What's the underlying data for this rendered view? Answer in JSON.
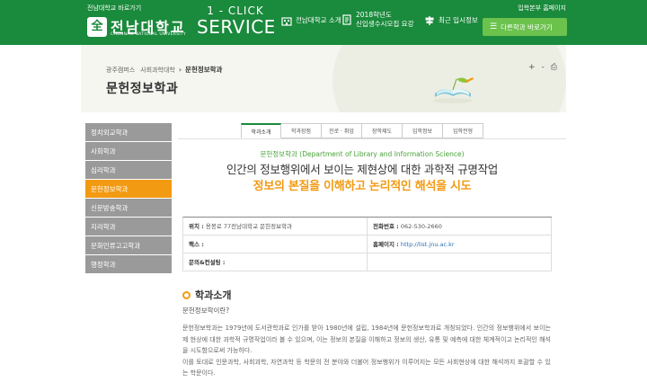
{
  "header": {
    "top_left_link": "전남대학교 바로가기",
    "top_right_link": "입학본부 홈페이지",
    "logo_ko": "전남대학교",
    "logo_en": "CHONNAM NATIONAL UNIVERSITY",
    "service_line1": "1 - CLICK",
    "service_line2": "SERVICE",
    "nav": [
      {
        "label": "전남대학교 소개",
        "icon": "building-icon"
      },
      {
        "label_line1": "2018학년도",
        "label_line2": "신입생수시모집 요강",
        "icon": "document-icon"
      },
      {
        "label": "최근 입시정보",
        "icon": "signpost-icon"
      }
    ],
    "quick_button": "다른학과 바로가기"
  },
  "banner": {
    "breadcrumb": [
      "광주캠퍼스",
      "사회과학대학",
      "문헌정보학과"
    ],
    "title": "문헌정보학과",
    "tools": [
      "+",
      "-",
      "⎙"
    ]
  },
  "sidebar": {
    "items": [
      {
        "label": "정치외교학과",
        "active": false
      },
      {
        "label": "사회학과",
        "active": false
      },
      {
        "label": "심리학과",
        "active": false
      },
      {
        "label": "문헌정보학과",
        "active": true
      },
      {
        "label": "신문방송학과",
        "active": false
      },
      {
        "label": "지리학과",
        "active": false
      },
      {
        "label": "문화인류고고학과",
        "active": false
      },
      {
        "label": "행정학과",
        "active": false
      }
    ]
  },
  "tabs": [
    {
      "label": "학과소개",
      "active": true
    },
    {
      "label": "학과장점",
      "active": false
    },
    {
      "label": "진로 · 취업",
      "active": false
    },
    {
      "label": "장학제도",
      "active": false
    },
    {
      "label": "입학정보",
      "active": false
    },
    {
      "label": "입학전형",
      "active": false
    }
  ],
  "headline": {
    "dept_en": "문헌정보학과 (Department of Library and Information Science)",
    "line1": "인간의 정보행위에서 보이는 제현상에 대한 과학적 규명작업",
    "line2": "정보의 본질을 이해하고 논리적인 해석을 시도"
  },
  "info": {
    "location_key": "위치 :",
    "location_val": "용봉로 77전남대학교 문헌정보학과",
    "phone_key": "전화번호 :",
    "phone_val": "062-530-2660",
    "fax_key": "팩스 :",
    "fax_val": "",
    "homepage_key": "홈페이지 :",
    "homepage_val": "http://list.jnu.ac.kr",
    "consult_key": "문의&컨설팅 :",
    "consult_val": ""
  },
  "intro": {
    "title": "학과소개",
    "question": "문헌정보학이란?",
    "paragraph1": "문헌정보학과는 1979년에 도서관학과로 인가를 받아 1980년에 설립, 1984년에 문헌정보학과로 개칭되었다. 인간의 정보행위에서 보이는 제 현상에 대한 과학적 규명작업이라 볼 수 있으며, 이는 정보의 본질을 이해하고 정보의 생산, 유통 및 예측에 대한 체계적이고 논리적인 해석을 시도함으로써 가능하다.",
    "paragraph2": "이를 토대로 인문과학, 사회과학, 자연과학 등 학문의 전 분야와 더불어 정보행위가 이루어지는 모든 사회현상에 대한 해석까지 포괄할 수 있는 학문이다."
  },
  "colors": {
    "brand_green": "#1a8a3c",
    "quick_button_green": "#6bc24d",
    "accent_orange": "#f29a12",
    "sidebar_gray": "#9a9a9a",
    "link_blue": "#2b6fb2"
  }
}
